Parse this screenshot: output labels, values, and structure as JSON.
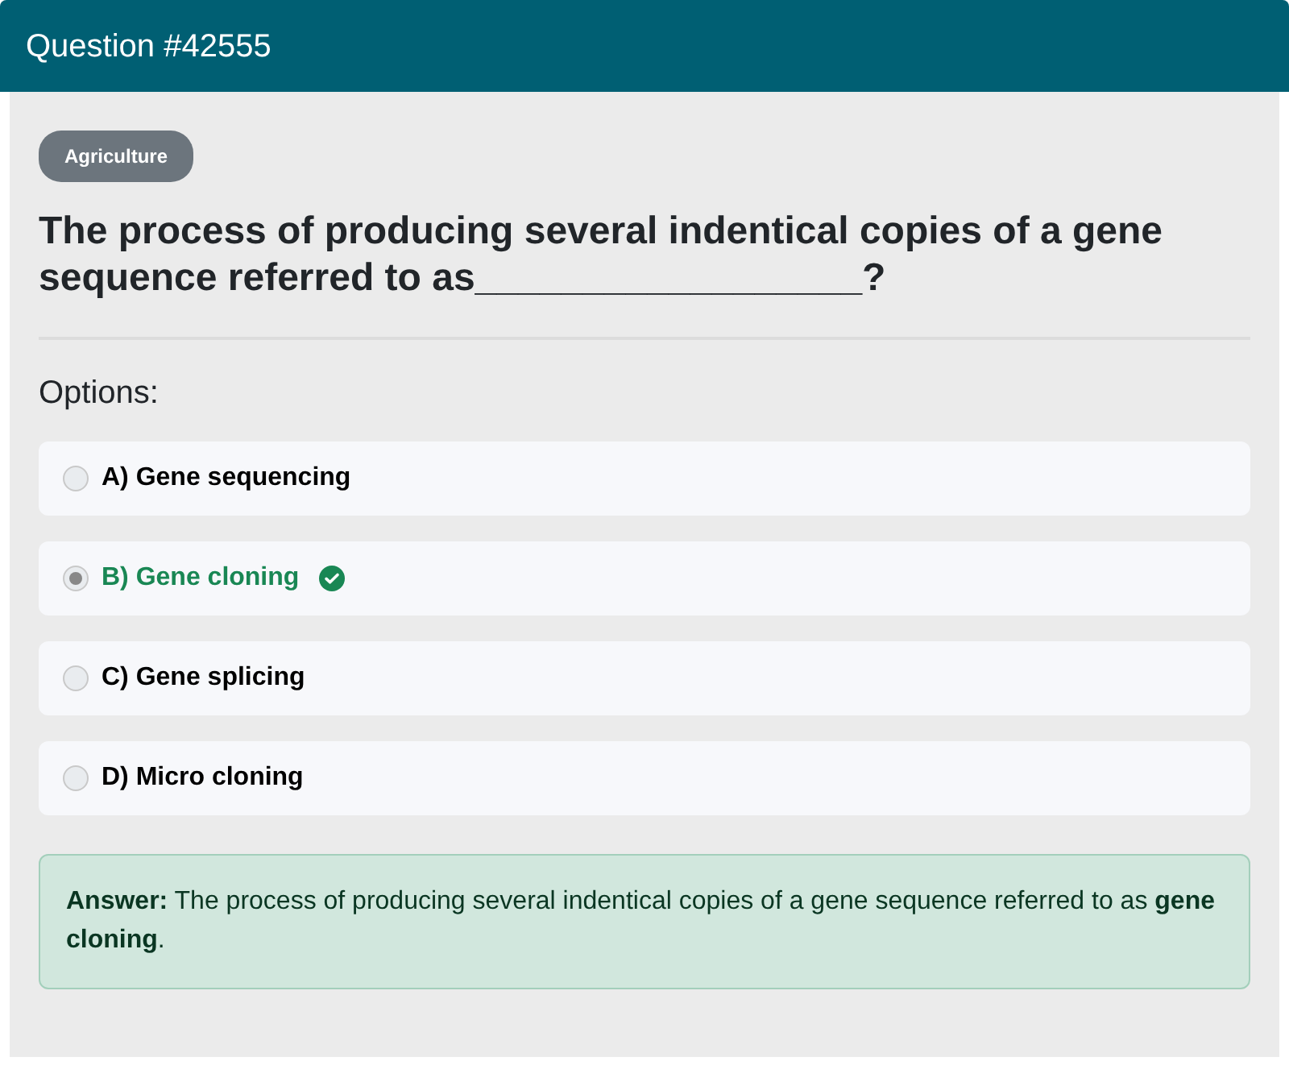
{
  "header": {
    "title": "Question #42555"
  },
  "category": "Agriculture",
  "question": "The process of producing several indentical copies of a gene sequence referred to as__________________?",
  "options_label": "Options:",
  "options": [
    {
      "label": "A) Gene sequencing",
      "selected": false,
      "correct": false
    },
    {
      "label": "B) Gene cloning",
      "selected": true,
      "correct": true
    },
    {
      "label": "C) Gene splicing",
      "selected": false,
      "correct": false
    },
    {
      "label": "D) Micro cloning",
      "selected": false,
      "correct": false
    }
  ],
  "answer": "**Answer:** The process of producing several indentical copies of a gene sequence referred to as **gene cloning**."
}
